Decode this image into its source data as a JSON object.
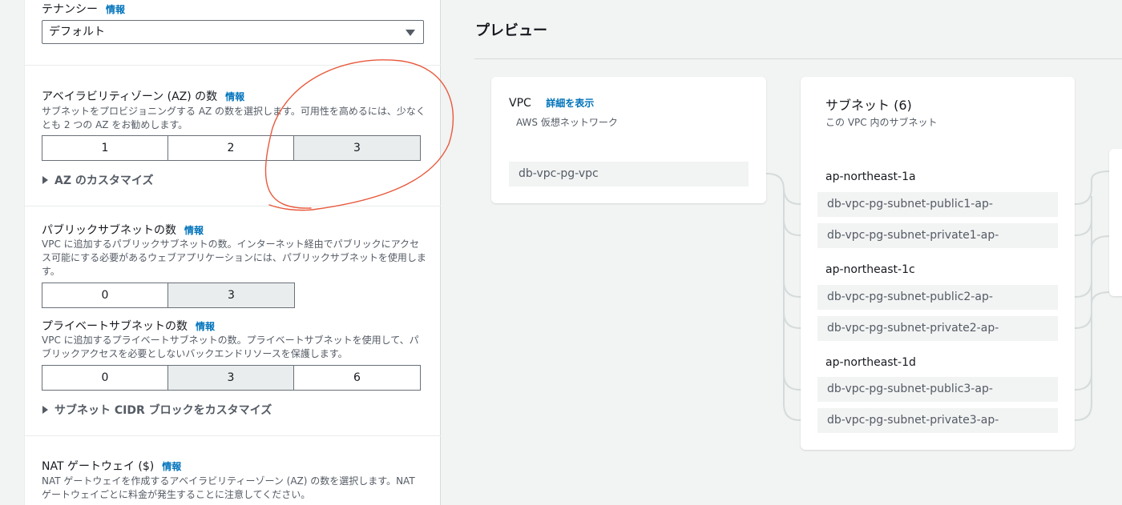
{
  "tenancy": {
    "label": "テナンシー",
    "info": "情報",
    "value": "デフォルト"
  },
  "az": {
    "label": "アベイラビリティゾーン (AZ) の数",
    "info": "情報",
    "desc": "サブネットをプロビジョニングする AZ の数を選択します。可用性を高めるには、少なくとも 2 つの AZ をお勧めします。",
    "options": [
      "1",
      "2",
      "3"
    ],
    "selected": "3",
    "customize": "AZ のカスタマイズ"
  },
  "public_subnets": {
    "label": "パブリックサブネットの数",
    "info": "情報",
    "desc": "VPC に追加するパブリックサブネットの数。インターネット経由でパブリックにアクセス可能にする必要があるウェブアプリケーションには、パブリックサブネットを使用します。",
    "options": [
      "0",
      "3"
    ],
    "selected": "3"
  },
  "private_subnets": {
    "label": "プライベートサブネットの数",
    "info": "情報",
    "desc": "VPC に追加するプライベートサブネットの数。プライベートサブネットを使用して、パブリックアクセスを必要としないバックエンドリソースを保護します。",
    "options": [
      "0",
      "3",
      "6"
    ],
    "selected": "3",
    "customize": "サブネット CIDR ブロックをカスタマイズ"
  },
  "nat": {
    "label": "NAT ゲートウェイ ($)",
    "info": "情報",
    "desc": "NAT ゲートウェイを作成するアベイラビリティーゾーン (AZ) の数を選択します。NAT ゲートウェイごとに料金が発生することに注意してください。"
  },
  "preview": {
    "title": "プレビュー",
    "vpc": {
      "title": "VPC",
      "details_link": "詳細を表示",
      "subtitle": "AWS 仮想ネットワーク",
      "name": "db-vpc-pg-vpc"
    },
    "subnets": {
      "title": "サブネット (6)",
      "subtitle": "この VPC 内のサブネット",
      "groups": [
        {
          "az": "ap-northeast-1a",
          "items": [
            "db-vpc-pg-subnet-public1-ap-",
            "db-vpc-pg-subnet-private1-ap-"
          ]
        },
        {
          "az": "ap-northeast-1c",
          "items": [
            "db-vpc-pg-subnet-public2-ap-",
            "db-vpc-pg-subnet-private2-ap-"
          ]
        },
        {
          "az": "ap-northeast-1d",
          "items": [
            "db-vpc-pg-subnet-public3-ap-",
            "db-vpc-pg-subnet-private3-ap-"
          ]
        }
      ]
    }
  },
  "colors": {
    "link": "#0073bb",
    "annotation": "#e8593c",
    "selected_bg": "#eaeded"
  }
}
